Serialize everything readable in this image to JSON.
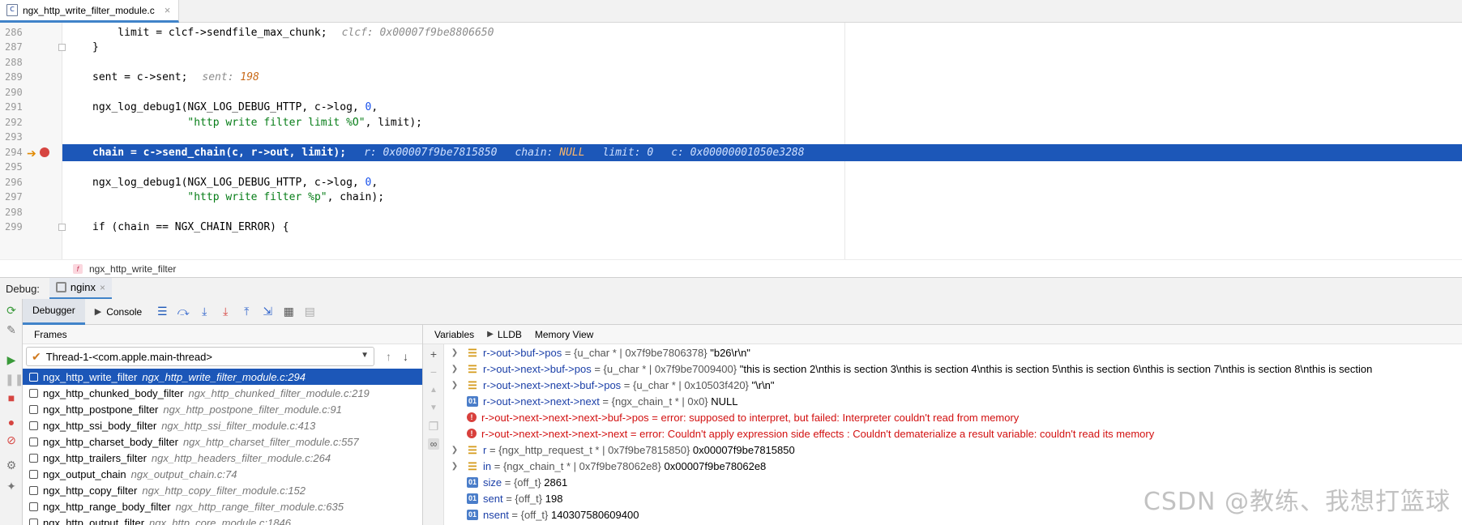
{
  "editor_tab": {
    "file": "ngx_http_write_filter_module.c",
    "close": "×"
  },
  "code_lines": [
    {
      "n": "286",
      "code": "    limit = clcf->sendfile_max_chunk;",
      "inline": "clcf: 0x00007f9be8806650"
    },
    {
      "n": "287",
      "code": "}",
      "inline": ""
    },
    {
      "n": "288",
      "code": "",
      "inline": ""
    },
    {
      "n": "289",
      "code": "sent = c->sent;",
      "inline": "sent: ",
      "inline_num": "198"
    },
    {
      "n": "290",
      "code": "",
      "inline": ""
    },
    {
      "n": "291",
      "code": "ngx_log_debug1(NGX_LOG_DEBUG_HTTP, c->log, 0,",
      "inline": ""
    },
    {
      "n": "292",
      "code": "               \"http write filter limit %O\", limit);",
      "inline": ""
    },
    {
      "n": "293",
      "code": "",
      "inline": ""
    },
    {
      "n": "294",
      "code": "chain = c->send_chain(c, r->out, limit);",
      "inline_r": "r: 0x00007f9be7815850",
      "inline_chain": "chain: ",
      "inline_null": "NULL",
      "inline_limit": "limit: 0",
      "inline_c": "c: 0x00000001050e3288"
    },
    {
      "n": "295",
      "code": "",
      "inline": ""
    },
    {
      "n": "296",
      "code": "ngx_log_debug1(NGX_LOG_DEBUG_HTTP, c->log, 0,",
      "inline": ""
    },
    {
      "n": "297",
      "code": "               \"http write filter %p\", chain);",
      "inline": ""
    },
    {
      "n": "298",
      "code": "",
      "inline": ""
    },
    {
      "n": "299",
      "code": "if (chain == NGX_CHAIN_ERROR) {",
      "inline": ""
    }
  ],
  "breadcrumb": {
    "icon": "f",
    "function": "ngx_http_write_filter"
  },
  "debug": {
    "label": "Debug:",
    "run_config": "nginx",
    "tabs": [
      "Debugger",
      "Console"
    ],
    "frames_title": "Frames",
    "thread": "Thread-1-<com.apple.main-thread>",
    "frames": [
      {
        "fn": "ngx_http_write_filter",
        "loc": "ngx_http_write_filter_module.c:294"
      },
      {
        "fn": "ngx_http_chunked_body_filter",
        "loc": "ngx_http_chunked_filter_module.c:219"
      },
      {
        "fn": "ngx_http_postpone_filter",
        "loc": "ngx_http_postpone_filter_module.c:91"
      },
      {
        "fn": "ngx_http_ssi_body_filter",
        "loc": "ngx_http_ssi_filter_module.c:413"
      },
      {
        "fn": "ngx_http_charset_body_filter",
        "loc": "ngx_http_charset_filter_module.c:557"
      },
      {
        "fn": "ngx_http_trailers_filter",
        "loc": "ngx_http_headers_filter_module.c:264"
      },
      {
        "fn": "ngx_output_chain",
        "loc": "ngx_output_chain.c:74"
      },
      {
        "fn": "ngx_http_copy_filter",
        "loc": "ngx_http_copy_filter_module.c:152"
      },
      {
        "fn": "ngx_http_range_body_filter",
        "loc": "ngx_http_range_filter_module.c:635"
      },
      {
        "fn": "ngx_http_output_filter",
        "loc": "ngx_http_core_module.c:1846"
      }
    ],
    "vars_tabs": [
      "Variables",
      "LLDB",
      "Memory View"
    ],
    "variables": [
      {
        "kind": "struct",
        "exp": true,
        "name": "r->out->buf->pos",
        "type": " = {u_char * | 0x7f9be7806378} ",
        "value": "\"b26\\r\\n\""
      },
      {
        "kind": "struct",
        "exp": true,
        "name": "r->out->next->buf->pos",
        "type": " = {u_char * | 0x7f9be7009400} ",
        "value": "\"this is section 2\\nthis is section 3\\nthis is section 4\\nthis is section 5\\nthis is section 6\\nthis is section 7\\nthis is section 8\\nthis is section"
      },
      {
        "kind": "struct",
        "exp": true,
        "name": "r->out->next->next->buf->pos",
        "type": " = {u_char * | 0x10503f420} ",
        "value": "\"\\r\\n\""
      },
      {
        "kind": "prim",
        "exp": false,
        "name": "r->out->next->next->next",
        "type": " = {ngx_chain_t * | 0x0} ",
        "value": "NULL"
      },
      {
        "kind": "err",
        "exp": false,
        "name": "r->out->next->next->next->buf->pos",
        "type": "",
        "value": " = error: supposed to interpret, but failed: Interpreter couldn't read from memory"
      },
      {
        "kind": "err",
        "exp": false,
        "name": "r->out->next->next->next->next",
        "type": "",
        "value": " = error: Couldn't apply expression side effects : Couldn't dematerialize a result variable: couldn't read its memory"
      },
      {
        "kind": "struct",
        "exp": true,
        "name": "r",
        "type": " = {ngx_http_request_t * | 0x7f9be7815850} ",
        "value": "0x00007f9be7815850"
      },
      {
        "kind": "struct",
        "exp": true,
        "name": "in",
        "type": " = {ngx_chain_t * | 0x7f9be78062e8} ",
        "value": "0x00007f9be78062e8"
      },
      {
        "kind": "prim",
        "exp": false,
        "name": "size",
        "type": " = {off_t} ",
        "value": "2861"
      },
      {
        "kind": "prim",
        "exp": false,
        "name": "sent",
        "type": " = {off_t} ",
        "value": "198"
      },
      {
        "kind": "prim",
        "exp": false,
        "name": "nsent",
        "type": " = {off_t} ",
        "value": "140307580609400"
      }
    ]
  },
  "watermark": "CSDN @教练、我想打篮球",
  "icons": {
    "prim_badge": "01",
    "struct_badge": "☰",
    "err_badge": "!"
  }
}
